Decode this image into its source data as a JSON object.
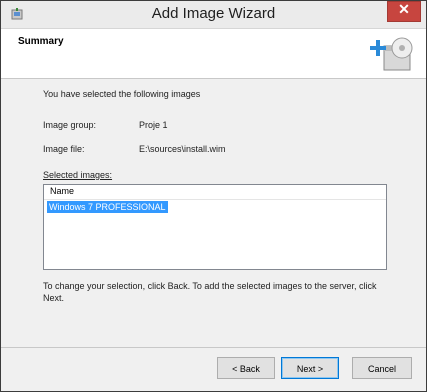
{
  "window": {
    "title": "Add Image Wizard",
    "close_label": "✕"
  },
  "header": {
    "title": "Summary"
  },
  "content": {
    "intro": "You have selected the following images",
    "image_group_label": "Image group:",
    "image_group_value": "Proje 1",
    "image_file_label": "Image file:",
    "image_file_value": "E:\\sources\\install.wim",
    "selected_images_label": "Selected images:",
    "list": {
      "column_header": "Name",
      "items": [
        "Windows 7 PROFESSIONAL"
      ]
    },
    "help_text_line1": "To change your selection, click Back. To add the selected images to the server, click",
    "help_text_line2": "Next."
  },
  "buttons": {
    "back": "< Back",
    "next": "Next >",
    "cancel": "Cancel"
  },
  "colors": {
    "selection": "#3399ff",
    "close": "#c7453f"
  }
}
